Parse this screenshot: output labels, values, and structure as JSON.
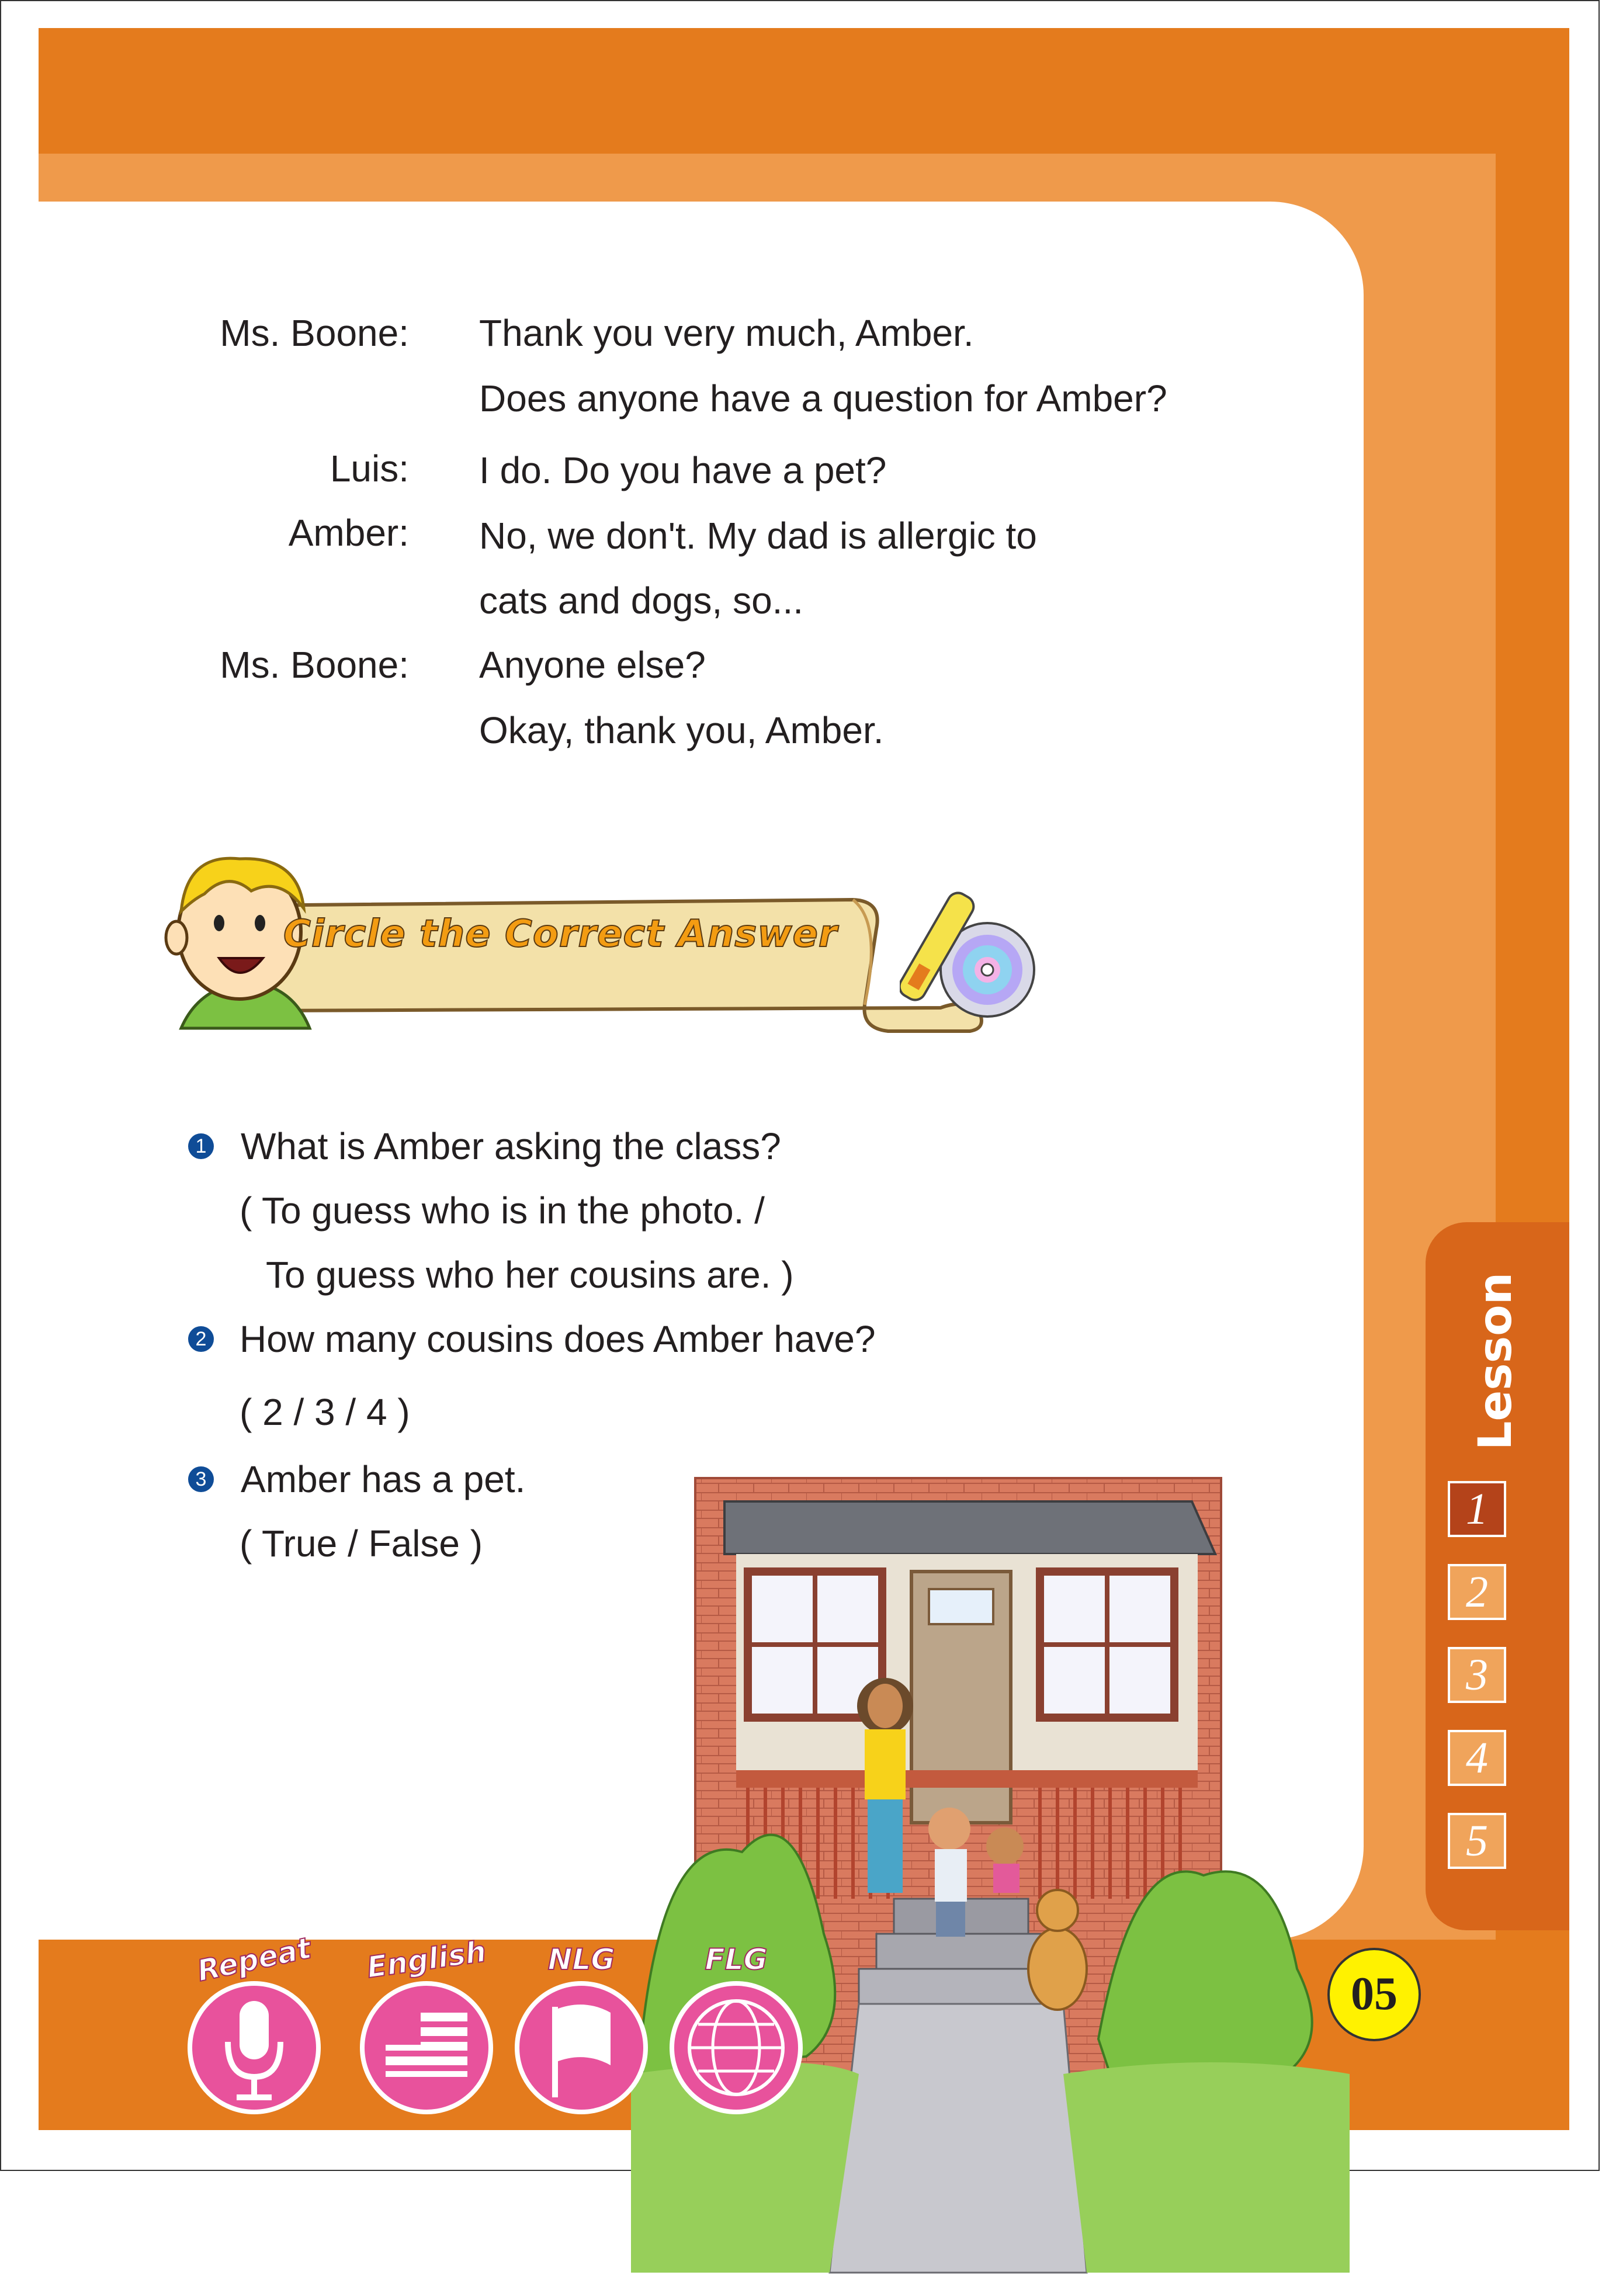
{
  "dialogue": [
    {
      "speaker": "Ms. Boone:",
      "lines": [
        "Thank you very much, Amber.",
        "Does anyone have a question for Amber?"
      ]
    },
    {
      "speaker": "Luis:",
      "lines": [
        "I do. Do you have a pet?"
      ]
    },
    {
      "speaker": "Amber:",
      "lines": [
        "No, we don't. My dad is allergic to",
        "cats and dogs, so..."
      ]
    },
    {
      "speaker": "Ms. Boone:",
      "lines": [
        "Anyone else?",
        "Okay, thank you, Amber."
      ]
    }
  ],
  "activity": {
    "title": "Circle the Correct Answer"
  },
  "questions": [
    {
      "number": "1",
      "text": "What is Amber asking the class?",
      "options": [
        "( To guess who is in the photo.  /",
        "To guess who her cousins are. )"
      ]
    },
    {
      "number": "2",
      "text": "How many cousins does Amber have?",
      "options": [
        "( 2  /  3  /  4 )"
      ]
    },
    {
      "number": "3",
      "text": "Amber has a pet.",
      "options": [
        "( True  /  False  )"
      ]
    }
  ],
  "lesson": {
    "label": "Lesson",
    "numbers": [
      "1",
      "2",
      "3",
      "4",
      "5"
    ],
    "active": "1"
  },
  "page_number": "05",
  "bottom_icons": [
    {
      "label": "Repeat",
      "icon": "microphone-icon"
    },
    {
      "label": "English",
      "icon": "us-flag-icon"
    },
    {
      "label": "NLG",
      "icon": "flag-icon"
    },
    {
      "label": "FLG",
      "icon": "globe-icon"
    }
  ],
  "colors": {
    "orange": "#e47b1d",
    "light_orange": "#ef9a4b",
    "pink": "#e8529c",
    "badge": "#fff200",
    "number_bullet": "#0f4c97"
  }
}
